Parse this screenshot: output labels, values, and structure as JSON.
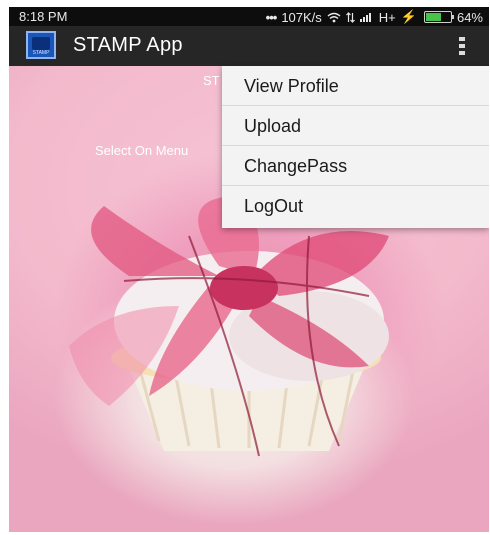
{
  "status_bar": {
    "time": "8:18 PM",
    "network_speed": "107K/s",
    "network_type": "H+",
    "battery": "64%",
    "battery_level": 0.64,
    "battery_color": "#49c24a",
    "icons": [
      "dots-icon",
      "wifi-icon",
      "data-arrows-icon",
      "signal-icon",
      "charging-icon",
      "battery-icon"
    ]
  },
  "app_bar": {
    "title": "STAMP App",
    "logo_text": "STAMP",
    "background": "#262626"
  },
  "content": {
    "heading_partial": "ST",
    "instruction_partial": "Select On Menu"
  },
  "menu": {
    "items": [
      {
        "label": "View Profile"
      },
      {
        "label": "Upload"
      },
      {
        "label": "ChangePass"
      },
      {
        "label": "LogOut"
      }
    ]
  }
}
